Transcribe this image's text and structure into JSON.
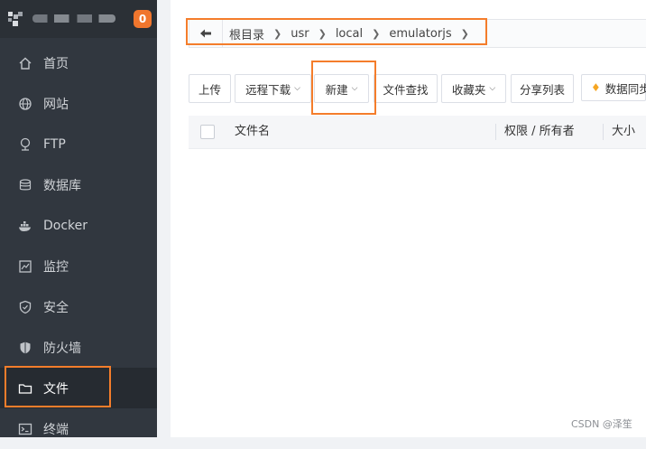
{
  "sidebar": {
    "badge": "0",
    "items": [
      {
        "label": "首页",
        "icon": "home-icon"
      },
      {
        "label": "网站",
        "icon": "globe-icon"
      },
      {
        "label": "FTP",
        "icon": "ftp-icon"
      },
      {
        "label": "数据库",
        "icon": "database-icon"
      },
      {
        "label": "Docker",
        "icon": "docker-icon"
      },
      {
        "label": "监控",
        "icon": "monitor-icon"
      },
      {
        "label": "安全",
        "icon": "shield-icon"
      },
      {
        "label": "防火墙",
        "icon": "firewall-icon"
      },
      {
        "label": "文件",
        "icon": "folder-icon"
      },
      {
        "label": "终端",
        "icon": "terminal-icon"
      }
    ],
    "active_item": "文件"
  },
  "breadcrumb": {
    "back_icon": "back-arrow-icon",
    "items": [
      "根目录",
      "usr",
      "local",
      "emulatorjs"
    ]
  },
  "toolbar": {
    "upload": "上传",
    "remote_download": "远程下载",
    "new": "新建",
    "file_search": "文件查找",
    "favorites": "收藏夹",
    "share_list": "分享列表",
    "data_sync": "数据同步"
  },
  "table": {
    "columns": [
      "文件名",
      "权限 / 所有者",
      "大小"
    ]
  },
  "watermark": "CSDN @泽笙",
  "colors": {
    "sidebar_bg": "#31373f",
    "highlight": "#f47d2b",
    "badge": "#f0762d"
  }
}
